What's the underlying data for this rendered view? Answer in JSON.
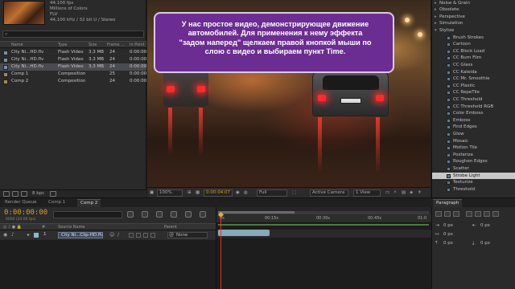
{
  "project": {
    "meta": [
      "44,100 fps",
      "Millions of Colors",
      "FLV",
      "44,100 kHz / 32 bit U / Stereo"
    ],
    "search_placeholder": "",
    "columns": [
      "Name",
      "Type",
      "Size",
      "Frame ...",
      "In Point"
    ],
    "items": [
      {
        "name": "City Ni...HD.flv",
        "type": "Flash Video",
        "size": "3,3 MB",
        "frame": "24",
        "inpoint": "0:00:00",
        "kind": "file",
        "selected": false
      },
      {
        "name": "City Ni...HD.flv",
        "type": "Flash Video",
        "size": "3,3 MB",
        "frame": "24",
        "inpoint": "0:00:00",
        "kind": "file",
        "selected": false
      },
      {
        "name": "City Ni...HD.flv",
        "type": "Flash Video",
        "size": "3,3 MB",
        "frame": "24",
        "inpoint": "0:00:00",
        "kind": "file",
        "selected": true
      },
      {
        "name": "Comp 1",
        "type": "Composition",
        "size": "",
        "frame": "25",
        "inpoint": "0:00:00",
        "kind": "comp",
        "selected": false
      },
      {
        "name": "Comp 2",
        "type": "Composition",
        "size": "",
        "frame": "24",
        "inpoint": "0:00:00",
        "kind": "comp",
        "selected": false
      }
    ],
    "footer_bpc": "8 bpc"
  },
  "viewer": {
    "callout": "У нас простое видео, демонстрирующее движение\nавтомобилей. Для применения к нему эффекта\n\"задом наперед\" щелкаем правой кнопкой мыши по\nслою с видео и выбираем пункт Time.",
    "zoom": "100%",
    "timecode": "0:00:04:07",
    "resolution": "Full",
    "camera": "Active Camera",
    "view": "1 View"
  },
  "effects": {
    "items": [
      {
        "label": "Noise & Grain",
        "kind": "cat"
      },
      {
        "label": "Obsolete",
        "kind": "cat"
      },
      {
        "label": "Perspective",
        "kind": "cat"
      },
      {
        "label": "Simulation",
        "kind": "cat"
      },
      {
        "label": "Stylize",
        "kind": "cat-open"
      },
      {
        "label": "Brush Strokes",
        "kind": "fx"
      },
      {
        "label": "Cartoon",
        "kind": "fx"
      },
      {
        "label": "CC Block Load",
        "kind": "fx"
      },
      {
        "label": "CC Burn Film",
        "kind": "fx"
      },
      {
        "label": "CC Glass",
        "kind": "fx"
      },
      {
        "label": "CC Kaleida",
        "kind": "fx"
      },
      {
        "label": "CC Mr. Smoothie",
        "kind": "fx"
      },
      {
        "label": "CC Plastic",
        "kind": "fx"
      },
      {
        "label": "CC RepeTile",
        "kind": "fx"
      },
      {
        "label": "CC Threshold",
        "kind": "fx"
      },
      {
        "label": "CC Threshold RGB",
        "kind": "fx"
      },
      {
        "label": "Color Emboss",
        "kind": "fx"
      },
      {
        "label": "Emboss",
        "kind": "fx"
      },
      {
        "label": "Find Edges",
        "kind": "fx"
      },
      {
        "label": "Glow",
        "kind": "fx"
      },
      {
        "label": "Mosaic",
        "kind": "fx"
      },
      {
        "label": "Motion Tile",
        "kind": "fx"
      },
      {
        "label": "Posterize",
        "kind": "fx"
      },
      {
        "label": "Roughen Edges",
        "kind": "fx"
      },
      {
        "label": "Scatter",
        "kind": "fx"
      },
      {
        "label": "Strobe Light",
        "kind": "fx-sel"
      },
      {
        "label": "Texturize",
        "kind": "fx"
      },
      {
        "label": "Threshold",
        "kind": "fx"
      }
    ]
  },
  "tabs": {
    "render_queue": "Render Queue",
    "comp1": "Comp 1",
    "comp2": "Comp 2",
    "paragraph": "Paragraph"
  },
  "timeline": {
    "timecode": "0:00:00:00",
    "fps": "0000 (24.00 fps)",
    "columns": {
      "source": "Source Name",
      "parent": "Parent"
    },
    "layer": {
      "number": "1",
      "name": "City Ni...Clip-HD.flv",
      "parent": "None"
    },
    "ruler": [
      "0s",
      "00:15s",
      "00:30s",
      "00:45s",
      "01:0"
    ]
  },
  "paragraph": {
    "fields": [
      "0 px",
      "0 px",
      "0 px",
      "0 px",
      "0 px"
    ]
  }
}
